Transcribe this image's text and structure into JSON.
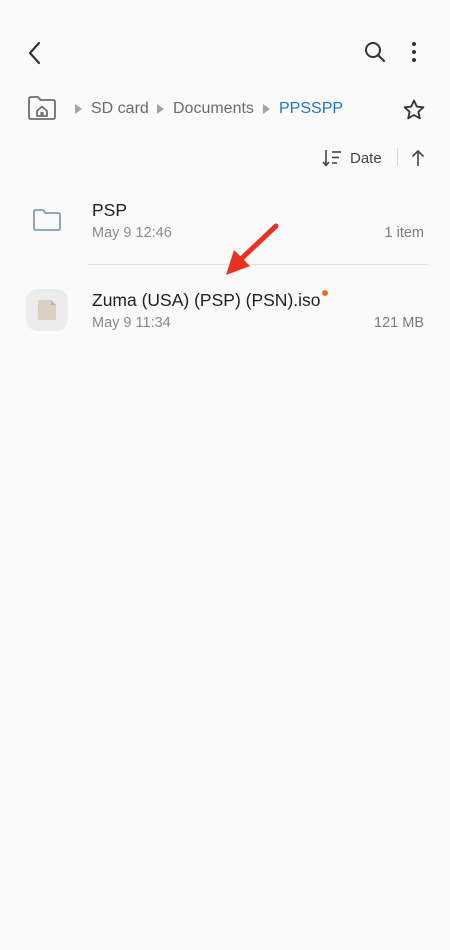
{
  "toolbar": {
    "back": "back-arrow-icon",
    "search": "search-icon",
    "more": "more-vert-icon"
  },
  "breadcrumb": {
    "home_icon": "home-folder-icon",
    "items": [
      {
        "label": "SD card"
      },
      {
        "label": "Documents"
      },
      {
        "label": "PPSSPP"
      }
    ],
    "favorite_icon": "star-outline-icon",
    "active_color": "#1877c9"
  },
  "sort": {
    "label": "Date",
    "direction": "ascending"
  },
  "files": [
    {
      "name": "PSP",
      "date": "May 9 12:46",
      "meta": "1 item",
      "icon": "folder-icon"
    },
    {
      "name": "Zuma (USA) (PSP) (PSN).iso",
      "date": "May 9 11:34",
      "meta": "121 MB",
      "icon": "file-icon",
      "new_dot_color": "#e0711a"
    }
  ],
  "annotation": {
    "arrow_color": "#e8321f"
  }
}
